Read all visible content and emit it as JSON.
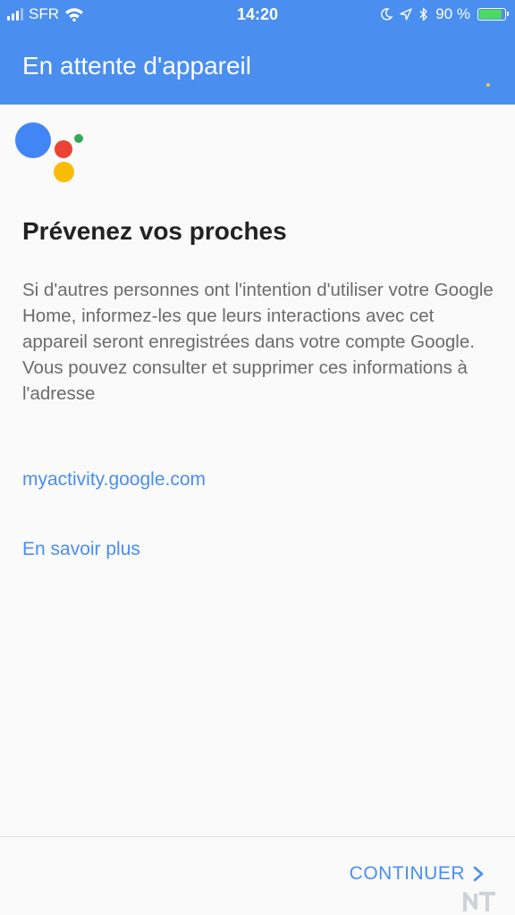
{
  "status_bar": {
    "carrier": "SFR",
    "time": "14:20",
    "battery_percent": "90 %",
    "battery_level": 0.9,
    "icons": [
      "signal-icon",
      "wifi-icon",
      "moon-icon",
      "location-arrow-icon",
      "bluetooth-icon",
      "battery-icon"
    ]
  },
  "header": {
    "title": "En attente d'appareil"
  },
  "content": {
    "heading": "Prévenez vos proches",
    "body": "Si d'autres personnes ont l'intention d'utiliser votre Google Home, informez-les que leurs interactions avec cet appareil seront enregistrées dans votre compte Google. Vous pouvez consulter et supprimer ces informations à l'adresse",
    "activity_link": "myactivity.google.com",
    "learn_more_link": "En savoir plus"
  },
  "footer": {
    "continue_label": "CONTINUER"
  },
  "colors": {
    "header_bg": "#4a8ef0",
    "link": "#4a8ef0",
    "assistant_blue": "#4285f4",
    "assistant_red": "#ea4335",
    "assistant_green": "#34a853",
    "assistant_yellow": "#fbbc05",
    "battery_fill": "#4cd964"
  }
}
